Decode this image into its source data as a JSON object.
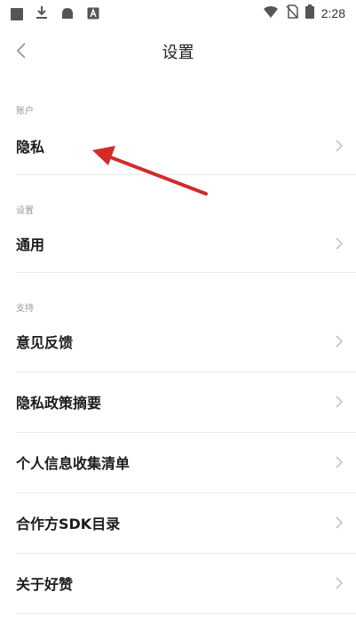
{
  "status_bar": {
    "time": "2:28",
    "icons": [
      "square-icon",
      "download-icon",
      "android-icon",
      "text-box-icon",
      "wifi-icon",
      "no-sim-icon",
      "battery-icon"
    ]
  },
  "header": {
    "back_icon": "chevron-left-icon",
    "title": "设置"
  },
  "sections": {
    "account": {
      "label": "账户",
      "items": [
        {
          "label": "隐私"
        }
      ]
    },
    "settings": {
      "label": "设置",
      "items": [
        {
          "label": "通用"
        }
      ]
    },
    "support": {
      "label": "支持",
      "items": [
        {
          "label": "意见反馈"
        },
        {
          "label": "隐私政策摘要"
        },
        {
          "label": "个人信息收集清单"
        },
        {
          "label": "合作方SDK目录"
        },
        {
          "label": "关于好赞"
        }
      ]
    }
  },
  "annotation": {
    "color": "#d42a2a",
    "points_to": "隐私"
  },
  "colors": {
    "section_label": "#9a9a9a",
    "divider": "#ececec",
    "chevron": "#c4c4c4"
  }
}
